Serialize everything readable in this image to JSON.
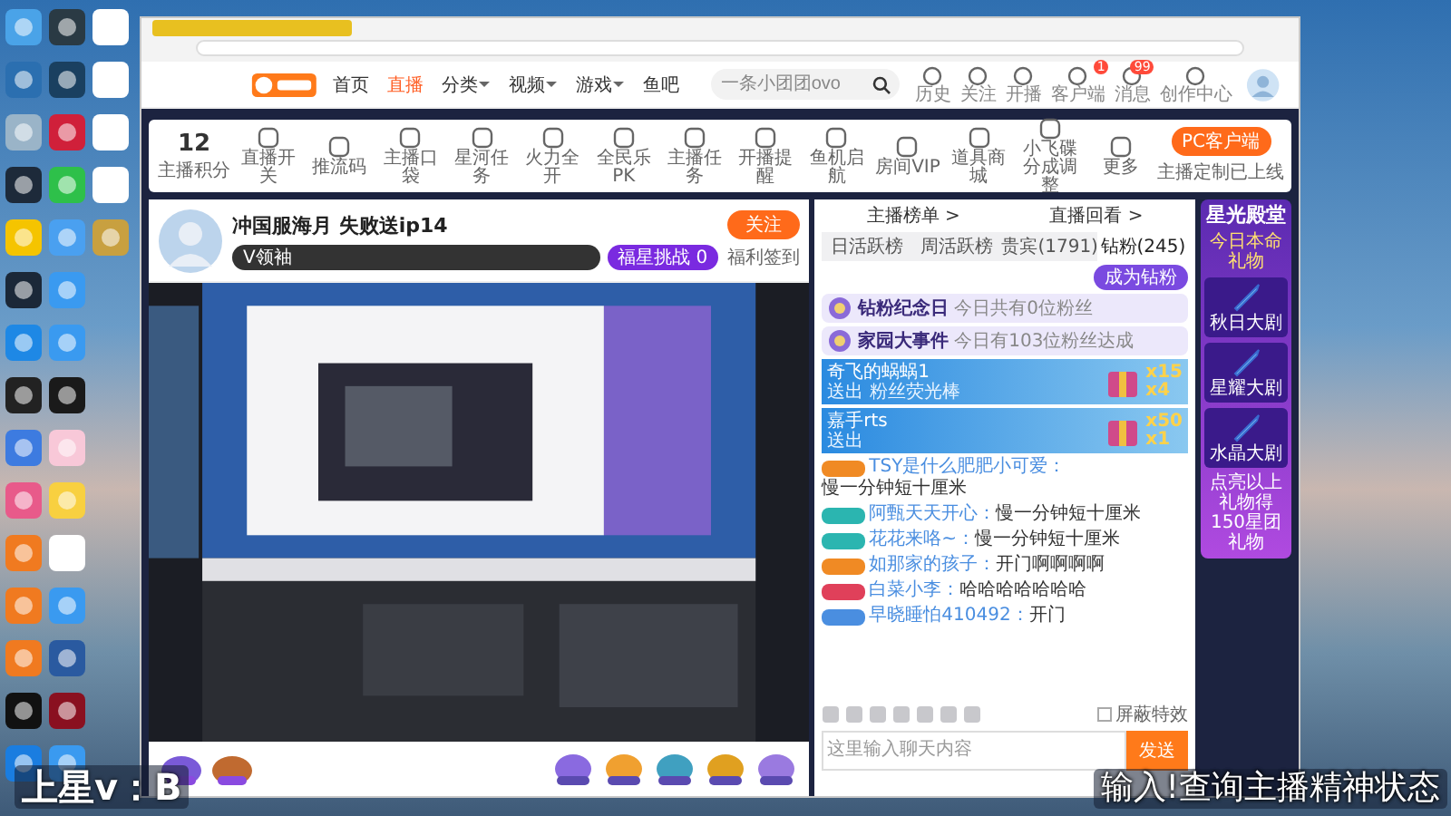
{
  "header": {
    "nav": [
      {
        "label": "首页",
        "selected": false,
        "dropdown": false
      },
      {
        "label": "直播",
        "selected": true,
        "dropdown": false
      },
      {
        "label": "分类",
        "selected": false,
        "dropdown": true
      },
      {
        "label": "视频",
        "selected": false,
        "dropdown": true
      },
      {
        "label": "游戏",
        "selected": false,
        "dropdown": true
      },
      {
        "label": "鱼吧",
        "selected": false,
        "dropdown": false
      }
    ],
    "search": {
      "placeholder": "一条小团团ovo"
    },
    "icons": [
      {
        "label": "历史"
      },
      {
        "label": "关注"
      },
      {
        "label": "开播"
      },
      {
        "label": "客户端",
        "badge": "1"
      },
      {
        "label": "消息",
        "badge": "99"
      },
      {
        "label": "创作中心"
      }
    ]
  },
  "toolbar": {
    "score": "12",
    "score_label": "主播积分",
    "items": [
      "直播开关",
      "推流码",
      "主播口袋",
      "星河任务",
      "火力全开",
      "全民乐PK",
      "主播任务",
      "开播提醒",
      "鱼机启航",
      "房间VIP",
      "道具商城",
      "小飞碟分成调整",
      "更多"
    ],
    "client_button": "PC客户端",
    "client_note": "主播定制已上线"
  },
  "streamer": {
    "title": "冲国服海月 失败送ip14",
    "tags": [
      "V领袖",
      "福星挑战 0"
    ],
    "follow": "关注",
    "checkin": "福利签到"
  },
  "chat": {
    "links": [
      "主播榜单 >",
      "直播回看 >"
    ],
    "tabs": [
      {
        "label": "日活跃榜",
        "selected": false
      },
      {
        "label": "周活跃榜",
        "selected": false
      },
      {
        "label": "贵宾(1791)",
        "selected": false
      },
      {
        "label": "钻粉(245)",
        "selected": true
      }
    ],
    "join_button": "成为钻粉",
    "events": [
      {
        "title": "钻粉纪念日",
        "text": "今日共有0位粉丝"
      },
      {
        "title": "家园大事件",
        "text": "今日有103位粉丝达成"
      }
    ],
    "gifts": [
      {
        "user": "奇飞的蜗蜗1",
        "action": "送出 粉丝荧光棒",
        "count": "x15",
        "combo": "x4"
      },
      {
        "user": "嘉手rts",
        "action": "送出",
        "count": "x50",
        "combo": "x1"
      }
    ],
    "messages": [
      {
        "user": "TSY是什么肥肥小可爱：",
        "text": "慢一分钟短十厘米",
        "color": "#f08a24"
      },
      {
        "user": "阿甄天天开心：",
        "text": "慢一分钟短十厘米",
        "color": "#2bb5b0"
      },
      {
        "user": "花花来咯~：",
        "text": "慢一分钟短十厘米",
        "color": "#2bb5b0"
      },
      {
        "user": "如那家的孩子：",
        "text": "开门啊啊啊啊",
        "color": "#f08a24"
      },
      {
        "user": "白菜小李：",
        "text": "哈哈哈哈哈哈哈",
        "color": "#e0405a"
      },
      {
        "user": "早晓睡怕410492：",
        "text": "开门",
        "color": "#4a8ee0"
      }
    ],
    "block_effects": {
      "label": "屏蔽特效",
      "checked": false
    },
    "input": {
      "placeholder": "这里输入聊天内容"
    },
    "send": "发送"
  },
  "promo": {
    "title": "星光殿堂",
    "subtitle": "今日本命礼物",
    "items": [
      "秋日大剧",
      "星耀大剧",
      "水晶大剧"
    ],
    "note": "点亮以上礼物得150星团礼物"
  },
  "overlay": {
    "left": "上星v：B",
    "right": "输入!查询主播精神状态"
  }
}
